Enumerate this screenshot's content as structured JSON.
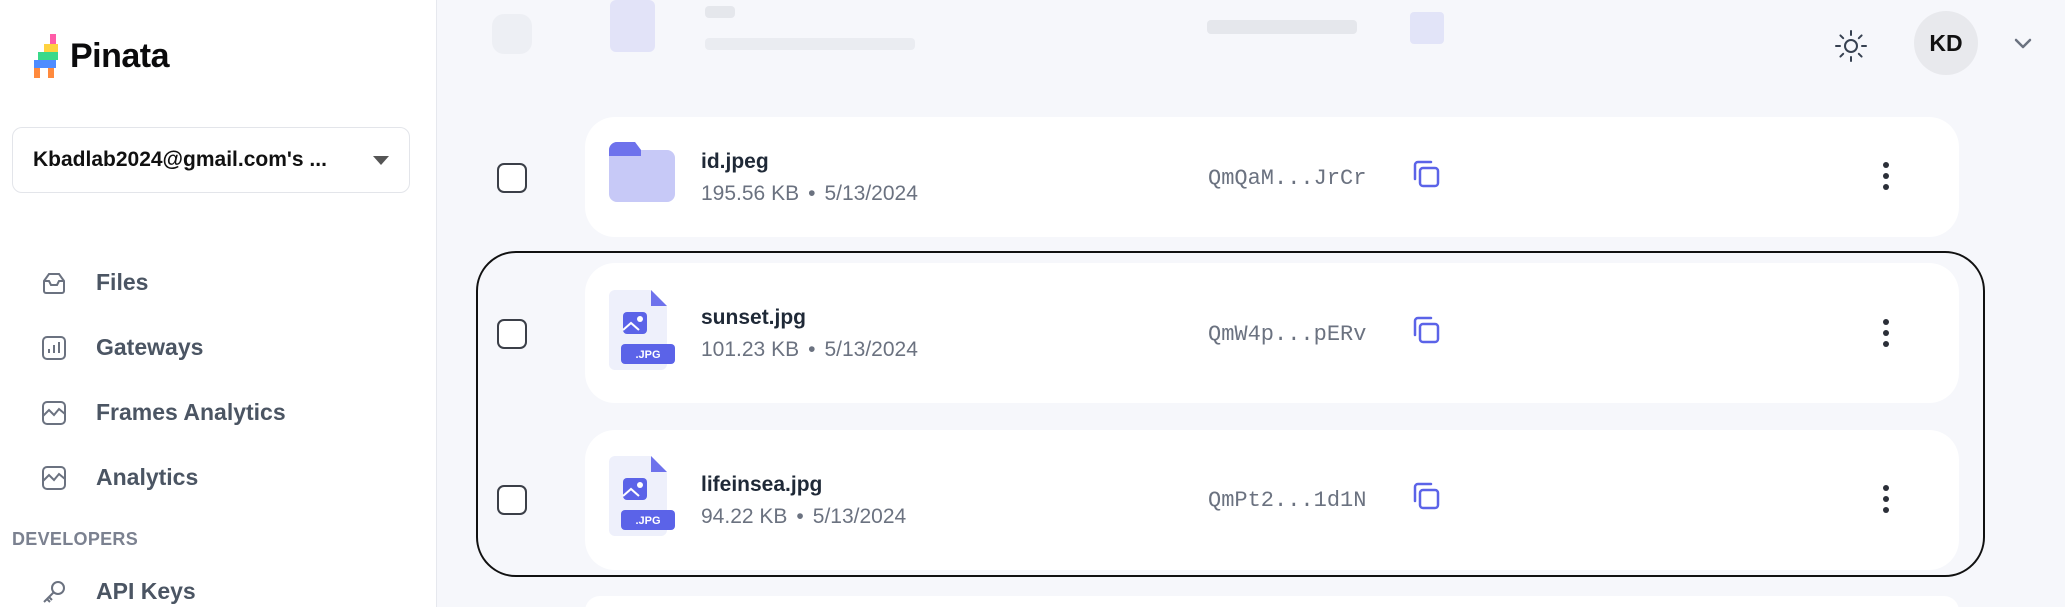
{
  "app": {
    "brand": "Pinata"
  },
  "sidebar": {
    "account": "Kbadlab2024@gmail.com's ...",
    "items": [
      {
        "label": "Files",
        "icon": "files-icon"
      },
      {
        "label": "Gateways",
        "icon": "gateways-icon"
      },
      {
        "label": "Frames Analytics",
        "icon": "frames-analytics-icon"
      },
      {
        "label": "Analytics",
        "icon": "analytics-icon"
      }
    ],
    "developers_title": "DEVELOPERS",
    "api_keys": {
      "label": "API Keys",
      "icon": "key-icon"
    }
  },
  "header": {
    "avatar_initials": "KD",
    "theme_icon": "sun-icon",
    "menu_icon": "chevron-down-icon"
  },
  "files": [
    {
      "name": "id.jpeg",
      "size": "195.56 KB",
      "date": "5/13/2024",
      "cid": "QmQaM...JrCr",
      "type": "folder"
    },
    {
      "name": "sunset.jpg",
      "size": "101.23 KB",
      "date": "5/13/2024",
      "cid": "QmW4p...pERv",
      "type": "jpg",
      "badge": ".JPG"
    },
    {
      "name": "lifeinsea.jpg",
      "size": "94.22 KB",
      "date": "5/13/2024",
      "cid": "QmPt2...1d1N",
      "type": "jpg",
      "badge": ".JPG"
    }
  ],
  "colors": {
    "accent": "#6366f1",
    "folder": "#c7c9f7",
    "badge": "#5b63e8"
  }
}
